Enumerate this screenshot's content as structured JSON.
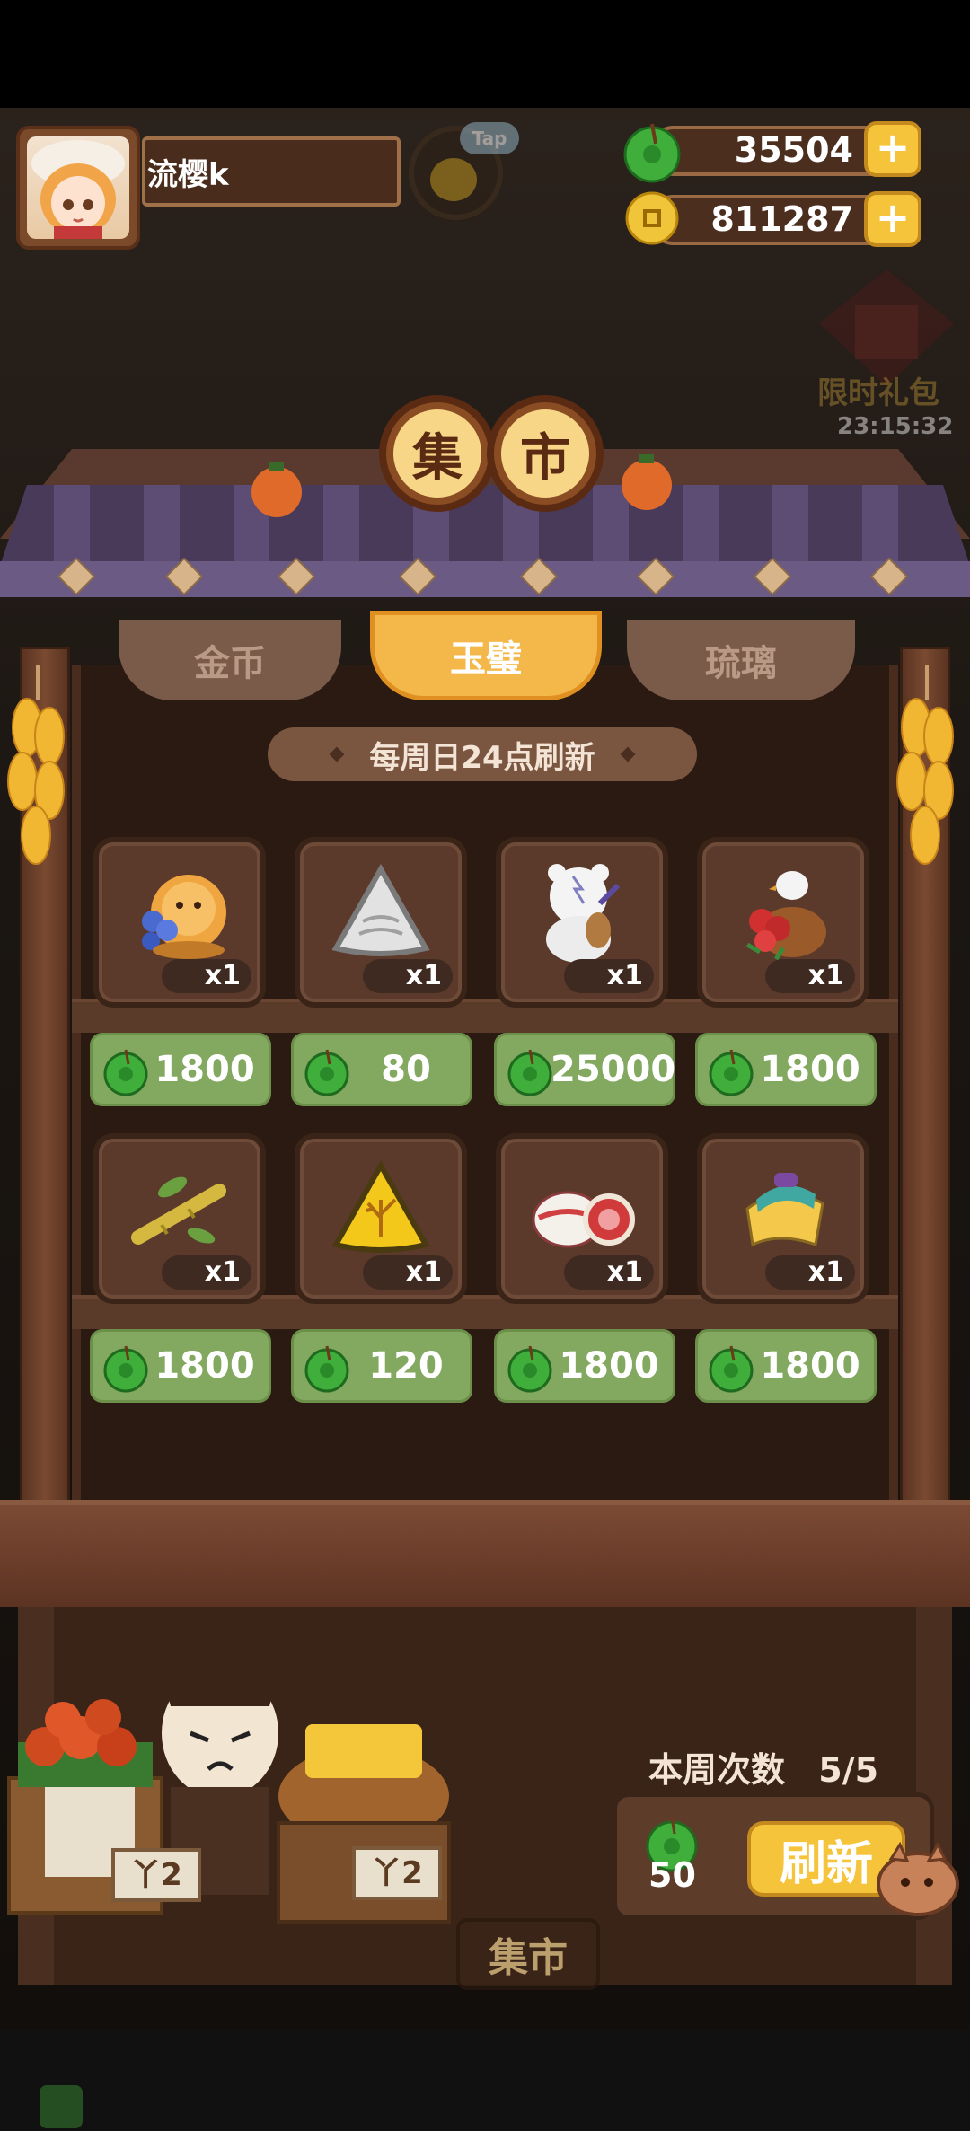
{
  "player": {
    "name": "流樱k"
  },
  "tap_hint": "Tap",
  "resources": [
    {
      "name": "jade",
      "icon": "jade-coin-icon",
      "value": "35504"
    },
    {
      "name": "gold",
      "icon": "gold-coin-icon",
      "value": "811287"
    }
  ],
  "limited_gift": {
    "label": "限时礼包",
    "timer": "23:15:32"
  },
  "shop": {
    "title_chars": [
      "集",
      "市"
    ],
    "tabs": [
      {
        "label": "金币",
        "active": false
      },
      {
        "label": "玉璧",
        "active": true
      },
      {
        "label": "琉璃",
        "active": false
      }
    ],
    "refresh_notice": "每周日24点刷新",
    "items": [
      {
        "icon": "dog-cat-with-flowers-icon",
        "qty": "x1",
        "price": "1800"
      },
      {
        "icon": "silver-triangle-token-icon",
        "qty": "x1",
        "price": "80"
      },
      {
        "icon": "polar-bear-with-lute-icon",
        "qty": "x1",
        "price": "25000"
      },
      {
        "icon": "bird-with-flower-pot-icon",
        "qty": "x1",
        "price": "1800"
      },
      {
        "icon": "bamboo-branch-icon",
        "qty": "x1",
        "price": "1800"
      },
      {
        "icon": "gold-triangle-token-icon",
        "qty": "x1",
        "price": "120"
      },
      {
        "icon": "porcelain-jar-icon",
        "qty": "x1",
        "price": "1800"
      },
      {
        "icon": "jade-comb-icon",
        "qty": "x1",
        "price": "1800"
      }
    ],
    "weekly_label": "本周次数",
    "weekly_count": "5/5",
    "refresh_cost": "50",
    "refresh_button": "刷新"
  },
  "stall_signs": [
    "丫2",
    "丫2"
  ],
  "bottom_tab": "集市",
  "colors": {
    "price_green": "#83a860",
    "gold_button": "#f5c43b",
    "wood_dark": "#3a2418"
  }
}
